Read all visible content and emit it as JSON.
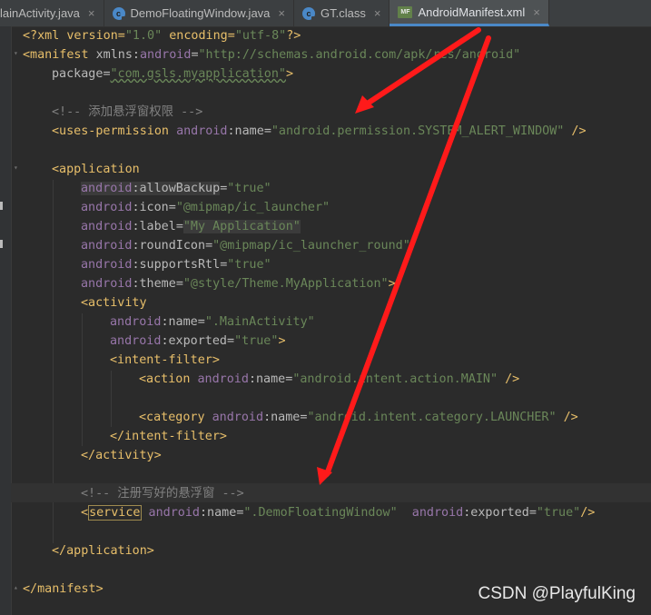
{
  "tabs": [
    {
      "label": "lainActivity.java",
      "icon": "java-class-icon",
      "active": false
    },
    {
      "label": "DemoFloatingWindow.java",
      "icon": "java-class-icon",
      "active": false
    },
    {
      "label": "GT.class",
      "icon": "java-class-icon",
      "active": false
    },
    {
      "label": "AndroidManifest.xml",
      "icon": "manifest-file-icon",
      "active": true
    }
  ],
  "close_glyph": "×",
  "manifest_icon_text": "MF",
  "class_icon_text": "c",
  "code": {
    "l1": {
      "a": "<?xml version=",
      "b": "\"1.0\"",
      "c": " encoding=",
      "d": "\"utf-8\"",
      "e": "?>"
    },
    "l2": {
      "a": "<manifest",
      "b": " xmlns:",
      "c": "android",
      "d": "=",
      "e": "\"http://schemas.android.com/apk/res/android\""
    },
    "l3": {
      "a": "package",
      "b": "=",
      "c": "\"com.gsls.myapplication\"",
      "d": ">"
    },
    "l5": {
      "a": "<!-- 添加悬浮窗权限 -->"
    },
    "l6": {
      "a": "<uses-permission",
      "b": "android",
      "c": ":name",
      "d": "=",
      "e": "\"android.permission.SYSTEM_ALERT_WINDOW\"",
      "f": " />"
    },
    "l8": {
      "a": "<application"
    },
    "l9": {
      "a": "android",
      "b": ":allowBackup",
      "c": "=",
      "d": "\"true\""
    },
    "l10": {
      "a": "android",
      "b": ":icon",
      "c": "=",
      "d": "\"@mipmap/ic_launcher\""
    },
    "l11": {
      "a": "android",
      "b": ":label",
      "c": "=",
      "d": "\"My Application\""
    },
    "l12": {
      "a": "android",
      "b": ":roundIcon",
      "c": "=",
      "d": "\"@mipmap/ic_launcher_round\""
    },
    "l13": {
      "a": "android",
      "b": ":supportsRtl",
      "c": "=",
      "d": "\"true\""
    },
    "l14": {
      "a": "android",
      "b": ":theme",
      "c": "=",
      "d": "\"@style/Theme.MyApplication\"",
      "e": ">"
    },
    "l15": {
      "a": "<activity"
    },
    "l16": {
      "a": "android",
      "b": ":name",
      "c": "=",
      "d": "\".MainActivity\""
    },
    "l17": {
      "a": "android",
      "b": ":exported",
      "c": "=",
      "d": "\"true\"",
      "e": ">"
    },
    "l18": {
      "a": "<intent-filter>"
    },
    "l19": {
      "a": "<action",
      "b": " android",
      "c": ":name",
      "d": "=",
      "e": "\"android.intent.action.MAIN\"",
      "f": " />"
    },
    "l21": {
      "a": "<category",
      "b": " android",
      "c": ":name",
      "d": "=",
      "e": "\"android.intent.category.LAUNCHER\"",
      "f": " />"
    },
    "l22": {
      "a": "</intent-filter>"
    },
    "l23": {
      "a": "</activity>"
    },
    "l25": {
      "a": "<!-- 注册写好的悬浮窗 -->"
    },
    "l26": {
      "a": "<",
      "b": "service",
      "c": " android",
      "d": ":name",
      "e": "=",
      "f": "\".DemoFloatingWindow\"",
      "g": "  android",
      "h": ":exported",
      "i": "=",
      "j": "\"true\"",
      "k": "/>"
    },
    "l28": {
      "a": "</application>"
    },
    "l30": {
      "a": "</manifest>"
    }
  },
  "watermark": "CSDN @PlayfulKing",
  "colors": {
    "arrow": "#ff1a1a",
    "tag": "#e8bf6a",
    "namespace": "#9876aa",
    "string": "#6a8759",
    "comment": "#808080"
  }
}
